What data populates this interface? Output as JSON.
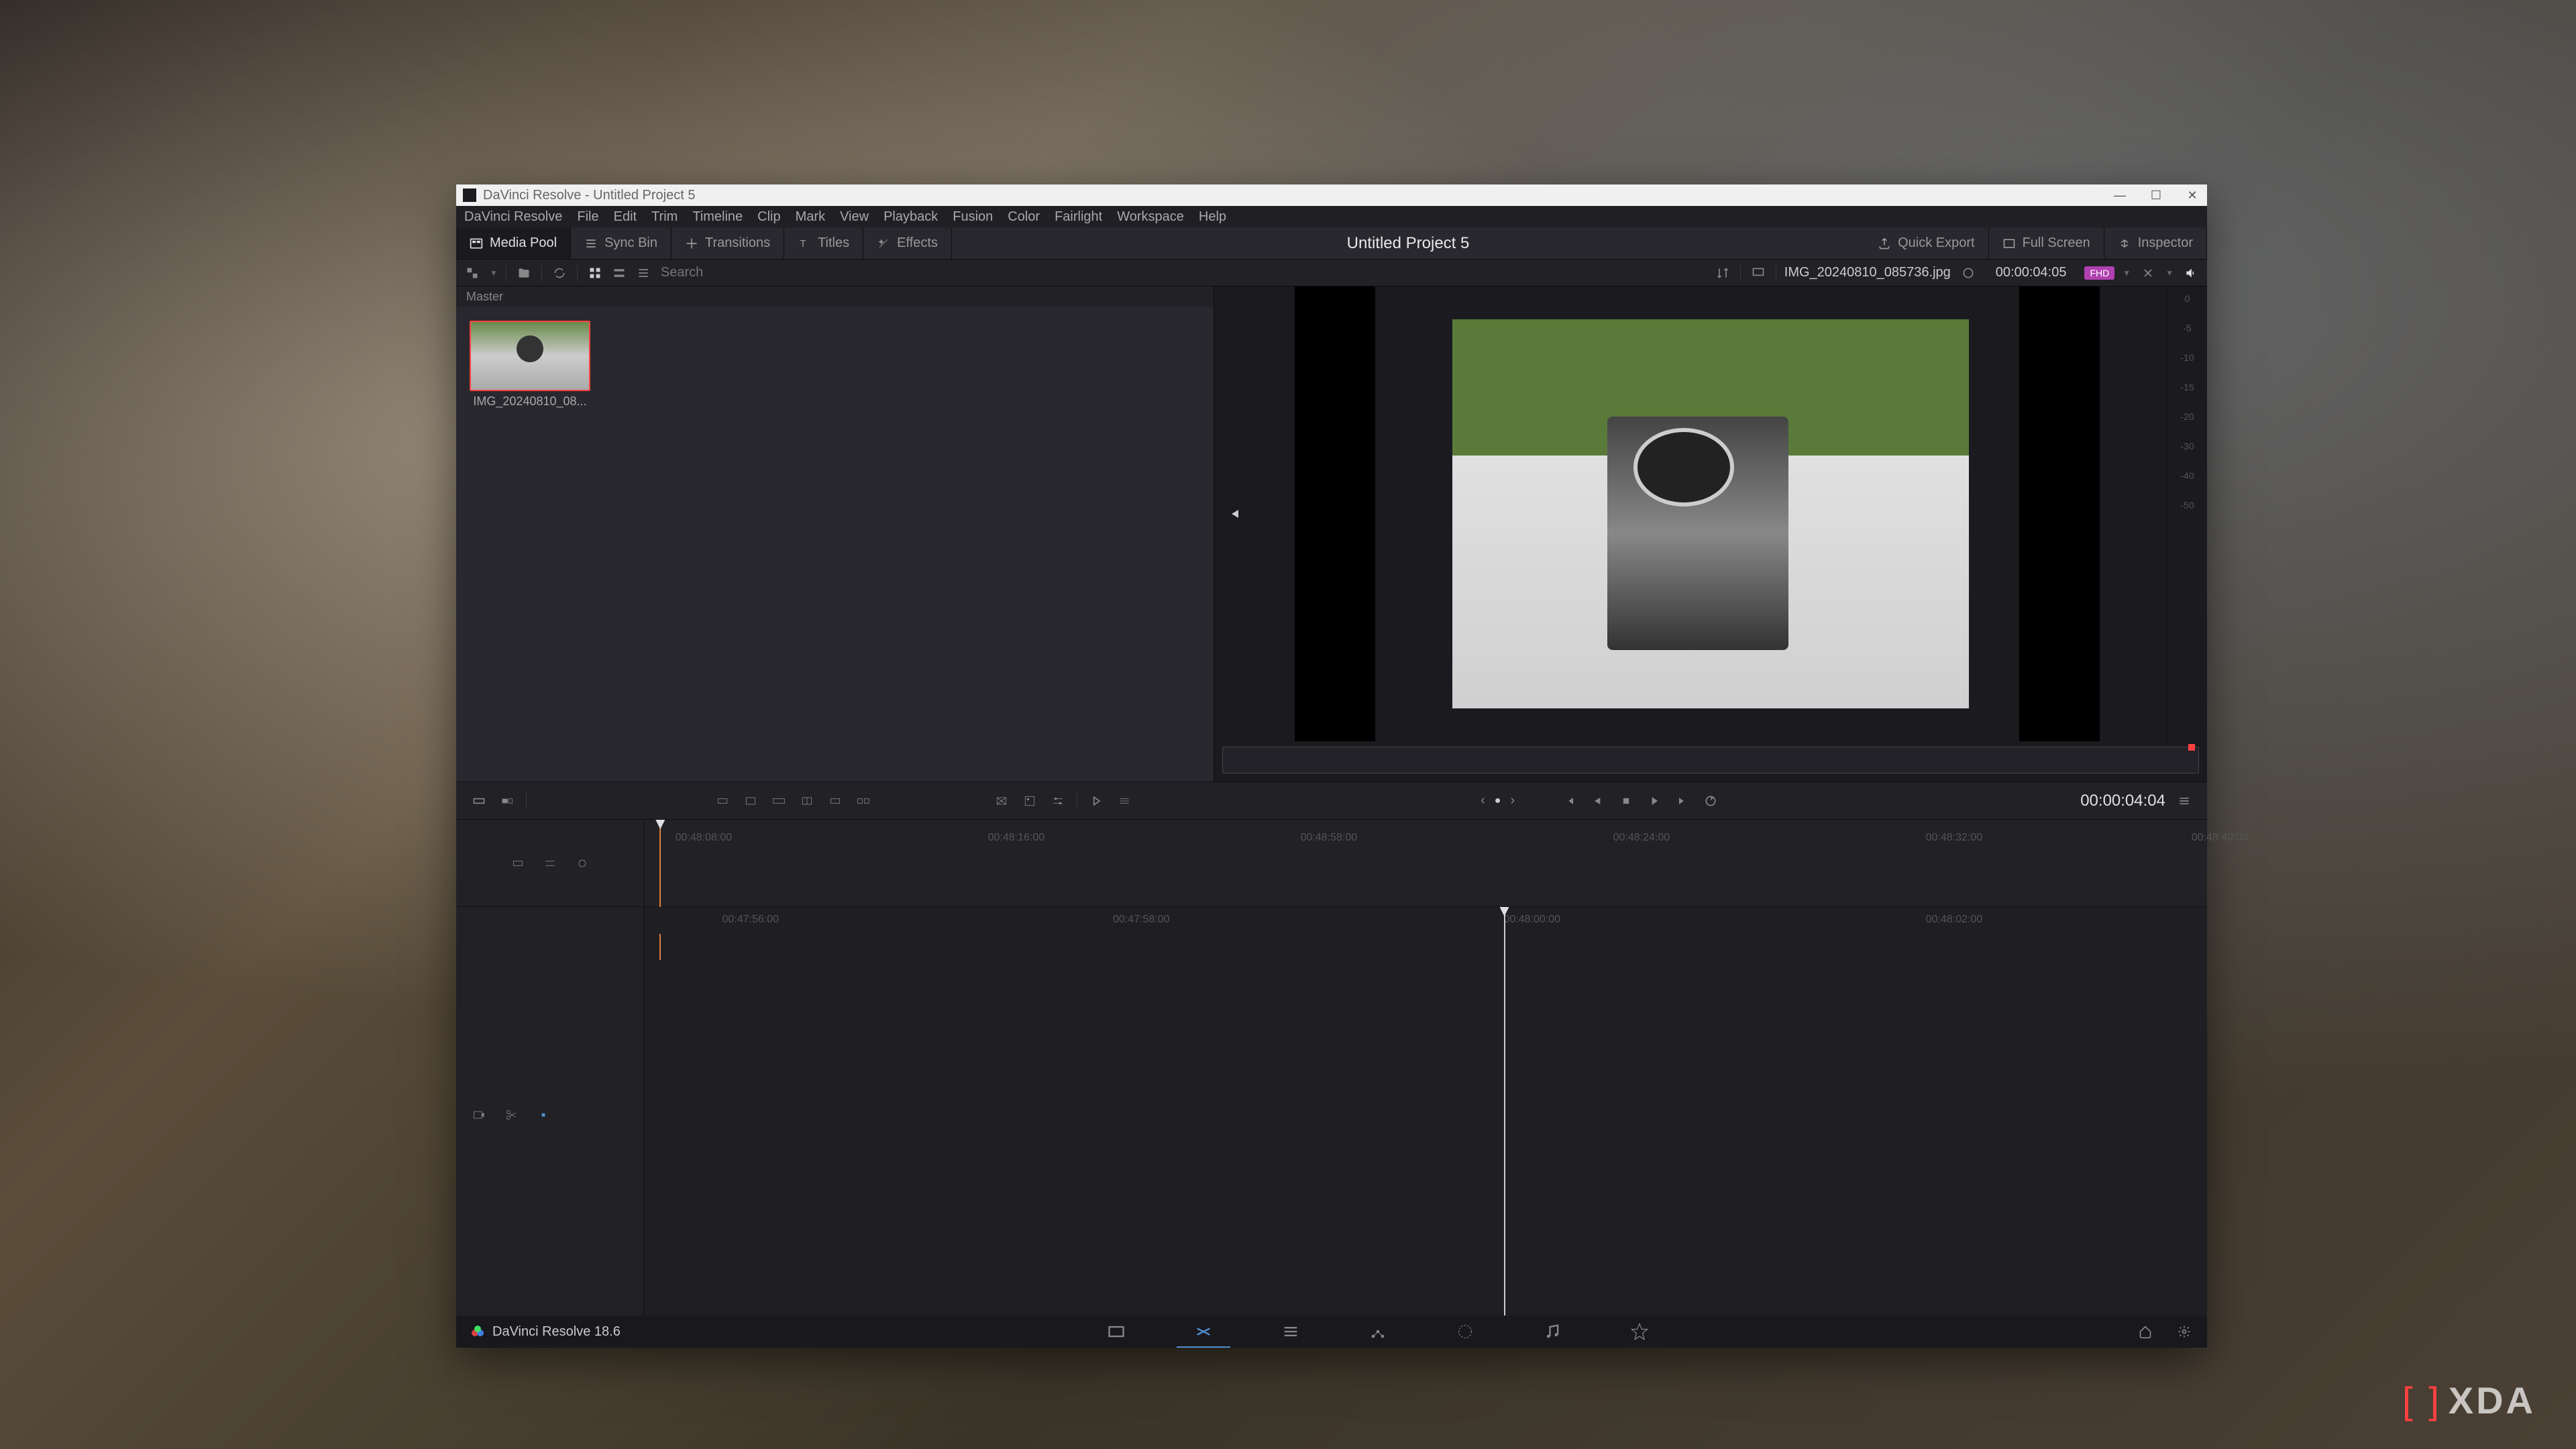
{
  "titlebar": {
    "title": "DaVinci Resolve - Untitled Project 5"
  },
  "menubar": [
    "DaVinci Resolve",
    "File",
    "Edit",
    "Trim",
    "Timeline",
    "Clip",
    "Mark",
    "View",
    "Playback",
    "Fusion",
    "Color",
    "Fairlight",
    "Workspace",
    "Help"
  ],
  "toolbar": {
    "media_pool": "Media Pool",
    "sync_bin": "Sync Bin",
    "transitions": "Transitions",
    "titles": "Titles",
    "effects": "Effects",
    "project_title": "Untitled Project 5",
    "quick_export": "Quick Export",
    "full_screen": "Full Screen",
    "inspector": "Inspector"
  },
  "secondary": {
    "search_placeholder": "Search"
  },
  "media_pool": {
    "master": "Master",
    "clip_name": "IMG_20240810_08..."
  },
  "viewer": {
    "filename": "IMG_20240810_085736.jpg",
    "timecode": "00:00:04:05",
    "res_badge": "FHD",
    "audio_ticks": [
      "0",
      "-5",
      "-10",
      "-15",
      "-20",
      "-30",
      "-40",
      "-50"
    ]
  },
  "playback": {
    "timecode": "00:00:04:04"
  },
  "timeline": {
    "upper_ticks": [
      {
        "pos": 2,
        "label": "00:48:08:00"
      },
      {
        "pos": 22,
        "label": "00:48:16:00"
      },
      {
        "pos": 42,
        "label": "00:48:58:00"
      },
      {
        "pos": 62,
        "label": "00:48:24:00"
      },
      {
        "pos": 82,
        "label": "00:48:32:00"
      },
      {
        "pos": 99,
        "label": "00:48:40:00"
      }
    ],
    "lower_ticks": [
      {
        "pos": 5,
        "label": "00:47:56:00"
      },
      {
        "pos": 30,
        "label": "00:47:58:00"
      },
      {
        "pos": 55,
        "label": "00:48:00:00"
      },
      {
        "pos": 82,
        "label": "00:48:02:00"
      }
    ]
  },
  "bottom": {
    "version": "DaVinci Resolve 18.6"
  },
  "watermark": {
    "text": "XDA"
  }
}
